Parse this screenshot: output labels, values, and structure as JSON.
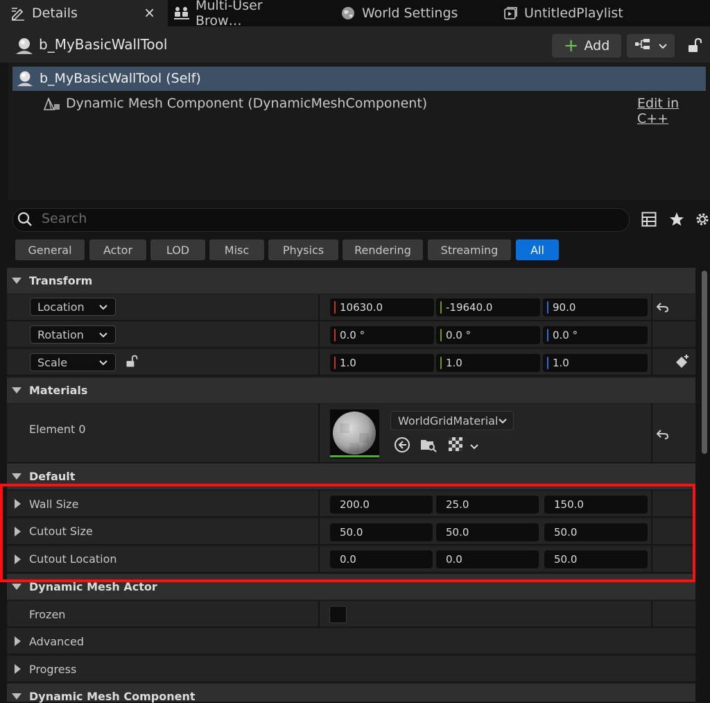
{
  "tabs": [
    {
      "label": "Details",
      "icon": "pencil-icon",
      "close": "×"
    },
    {
      "label": "Multi-User Brow…",
      "icon": "users-icon"
    },
    {
      "label": "World Settings",
      "icon": "globe-icon"
    },
    {
      "label": "UntitledPlaylist",
      "icon": "playlist-icon"
    }
  ],
  "header": {
    "actor_name": "b_MyBasicWallTool",
    "add_label": "Add"
  },
  "tree": {
    "self_label": "b_MyBasicWallTool (Self)",
    "component_label": "Dynamic Mesh Component (DynamicMeshComponent)",
    "edit_link": "Edit in C++"
  },
  "search": {
    "placeholder": "Search"
  },
  "filters": [
    "General",
    "Actor",
    "LOD",
    "Misc",
    "Physics",
    "Rendering",
    "Streaming",
    "All"
  ],
  "active_filter": "All",
  "transform": {
    "title": "Transform",
    "location": {
      "label": "Location",
      "x": "10630.0",
      "y": "-19640.0",
      "z": "90.0"
    },
    "rotation": {
      "label": "Rotation",
      "x": "0.0 °",
      "y": "0.0 °",
      "z": "0.0 °"
    },
    "scale": {
      "label": "Scale",
      "x": "1.0",
      "y": "1.0",
      "z": "1.0"
    }
  },
  "materials": {
    "title": "Materials",
    "element_label": "Element 0",
    "material_name": "WorldGridMaterial"
  },
  "default": {
    "title": "Default",
    "wall_size": {
      "label": "Wall Size",
      "x": "200.0",
      "y": "25.0",
      "z": "150.0"
    },
    "cutout_size": {
      "label": "Cutout Size",
      "x": "50.0",
      "y": "50.0",
      "z": "50.0"
    },
    "cutout_location": {
      "label": "Cutout Location",
      "x": "0.0",
      "y": "0.0",
      "z": "50.0"
    }
  },
  "dynamic_mesh_actor": {
    "title": "Dynamic Mesh Actor",
    "frozen_label": "Frozen",
    "frozen": false,
    "advanced_label": "Advanced",
    "progress_label": "Progress"
  },
  "dynamic_mesh_component": {
    "title": "Dynamic Mesh Component"
  },
  "colors": {
    "x_axis": "#c0392b",
    "y_axis": "#6a9b1c",
    "z_axis": "#2f6fd0",
    "selection": "#3e5066",
    "highlight_box": "#ff1010",
    "active_filter": "#0a6fd8"
  }
}
